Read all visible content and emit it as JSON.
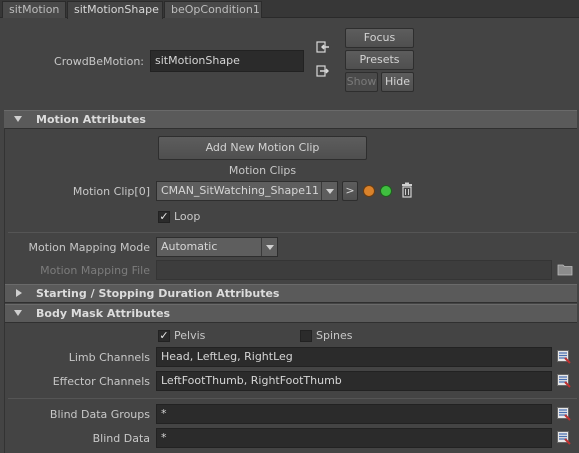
{
  "tabs": [
    {
      "label": "sitMotion"
    },
    {
      "label": "sitMotionShape"
    },
    {
      "label": "beOpCondition1"
    }
  ],
  "header": {
    "node_label": "CrowdBeMotion:",
    "node_value": "sitMotionShape",
    "focus_label": "Focus",
    "presets_label": "Presets",
    "show_label": "Show",
    "hide_label": "Hide"
  },
  "motion_attributes": {
    "title": "Motion Attributes",
    "add_clip_label": "Add New Motion Clip",
    "clips_heading": "Motion Clips",
    "clip_label": "Motion Clip[0]",
    "clip_value": "CMAN_SitWatching_Shape11",
    "clip_go_label": ">",
    "loop_label": "Loop",
    "loop_checked": true,
    "mapping_mode_label": "Motion Mapping Mode",
    "mapping_mode_value": "Automatic",
    "mapping_file_label": "Motion Mapping File",
    "mapping_file_value": ""
  },
  "starting_stopping": {
    "title": "Starting / Stopping Duration Attributes"
  },
  "body_mask": {
    "title": "Body Mask Attributes",
    "pelvis_label": "Pelvis",
    "pelvis_checked": true,
    "spines_label": "Spines",
    "spines_checked": false,
    "limb_label": "Limb Channels",
    "limb_value": "Head, LeftLeg, RightLeg",
    "effector_label": "Effector Channels",
    "effector_value": "LeftFootThumb, RightFootThumb",
    "blind_groups_label": "Blind Data Groups",
    "blind_groups_value": "*",
    "blind_data_label": "Blind Data",
    "blind_data_value": "*"
  },
  "colors": {
    "status_orange": "#d9822b",
    "status_green": "#3fbf3f"
  }
}
